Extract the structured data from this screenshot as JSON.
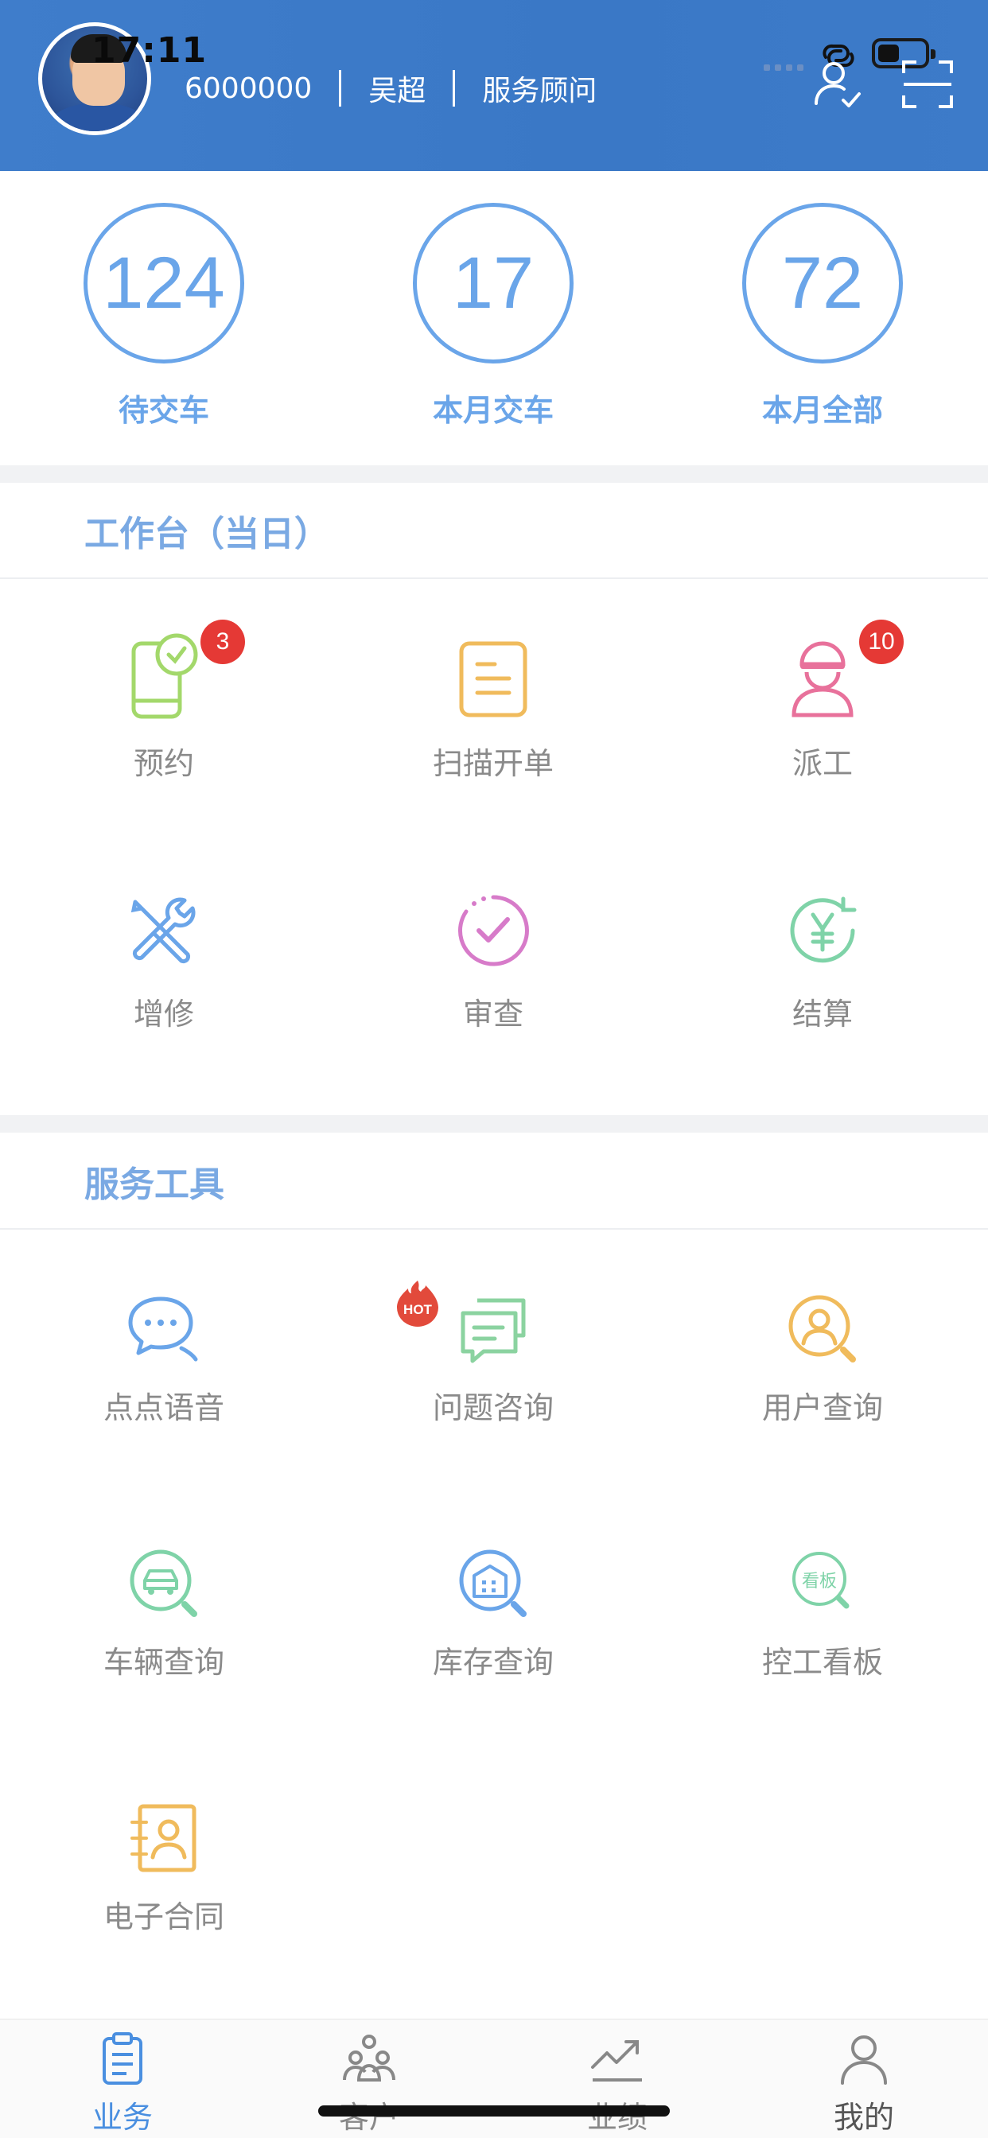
{
  "status": {
    "time": "17:11"
  },
  "header": {
    "user_id": "6000000",
    "name": "吴超",
    "role": "服务顾问"
  },
  "stats": [
    {
      "value": "124",
      "label": "待交车"
    },
    {
      "value": "17",
      "label": "本月交车"
    },
    {
      "value": "72",
      "label": "本月全部"
    }
  ],
  "workbench": {
    "title": "工作台（当日）",
    "items": [
      {
        "label": "预约",
        "icon": "phone-clock-icon",
        "badge": "3"
      },
      {
        "label": "扫描开单",
        "icon": "document-icon"
      },
      {
        "label": "派工",
        "icon": "worker-icon",
        "badge": "10"
      },
      {
        "label": "增修",
        "icon": "tools-icon"
      },
      {
        "label": "审查",
        "icon": "check-circle-icon"
      },
      {
        "label": "结算",
        "icon": "yen-refresh-icon"
      }
    ]
  },
  "tools": {
    "title": "服务工具",
    "hot_label": "HOT",
    "items": [
      {
        "label": "点点语音",
        "icon": "chat-bubble-icon"
      },
      {
        "label": "问题咨询",
        "icon": "message-icon"
      },
      {
        "label": "用户查询",
        "icon": "user-search-icon"
      },
      {
        "label": "车辆查询",
        "icon": "car-search-icon"
      },
      {
        "label": "库存查询",
        "icon": "building-search-icon"
      },
      {
        "label": "控工看板",
        "icon": "board-search-icon",
        "icon_text": "看板"
      },
      {
        "label": "电子合同",
        "icon": "contract-icon"
      }
    ]
  },
  "tabbar": [
    {
      "label": "业务",
      "icon": "clipboard-icon",
      "active": true
    },
    {
      "label": "客户",
      "icon": "customers-icon"
    },
    {
      "label": "业绩",
      "icon": "trend-icon"
    },
    {
      "label": "我的",
      "icon": "profile-icon"
    }
  ],
  "colors": {
    "header": "#3d7bc9",
    "accent": "#6aa5e9",
    "badge": "#e53935",
    "active_tab": "#4a8fe0"
  }
}
